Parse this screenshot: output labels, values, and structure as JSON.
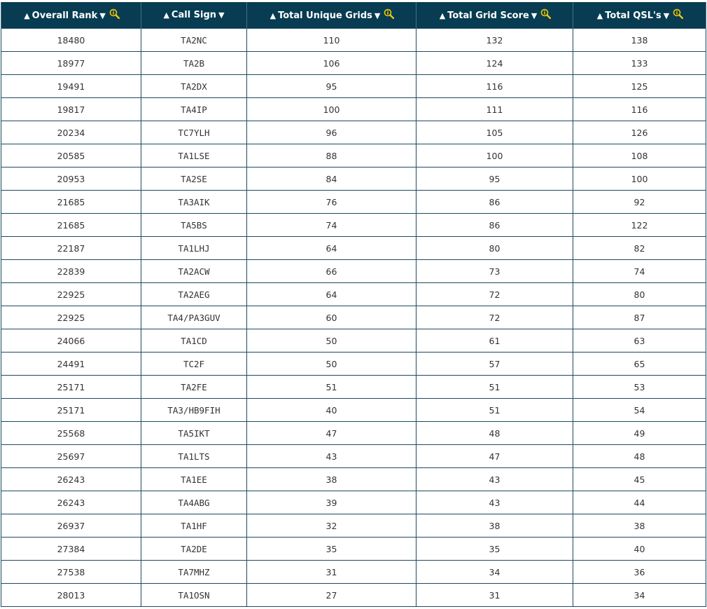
{
  "colors": {
    "header_bg": "#073c52",
    "header_text": "#ffffff",
    "icon": "#f2c800",
    "border": "#1e4a5e",
    "cell_text": "#333333"
  },
  "columns": [
    {
      "label": "Overall Rank",
      "sort_up": "▲",
      "sort_down": "▼",
      "has_search": true,
      "icon": "magnifier-info-icon"
    },
    {
      "label": "Call Sign",
      "sort_up": "▲",
      "sort_down": "▼",
      "has_search": false,
      "icon": ""
    },
    {
      "label": "Total Unique Grids",
      "sort_up": "▲",
      "sort_down": "▼",
      "has_search": true,
      "icon": "magnifier-info-icon"
    },
    {
      "label": "Total Grid Score",
      "sort_up": "▲",
      "sort_down": "▼",
      "has_search": true,
      "icon": "magnifier-info-icon"
    },
    {
      "label": "Total QSL's",
      "sort_up": "▲",
      "sort_down": "▼",
      "has_search": true,
      "icon": "magnifier-info-icon"
    }
  ],
  "rows": [
    [
      "18480",
      "TA2NC",
      "110",
      "132",
      "138"
    ],
    [
      "18977",
      "TA2B",
      "106",
      "124",
      "133"
    ],
    [
      "19491",
      "TA2DX",
      "95",
      "116",
      "125"
    ],
    [
      "19817",
      "TA4IP",
      "100",
      "111",
      "116"
    ],
    [
      "20234",
      "TC7YLH",
      "96",
      "105",
      "126"
    ],
    [
      "20585",
      "TA1LSE",
      "88",
      "100",
      "108"
    ],
    [
      "20953",
      "TA2SE",
      "84",
      "95",
      "100"
    ],
    [
      "21685",
      "TA3AIK",
      "76",
      "86",
      "92"
    ],
    [
      "21685",
      "TA5BS",
      "74",
      "86",
      "122"
    ],
    [
      "22187",
      "TA1LHJ",
      "64",
      "80",
      "82"
    ],
    [
      "22839",
      "TA2ACW",
      "66",
      "73",
      "74"
    ],
    [
      "22925",
      "TA2AEG",
      "64",
      "72",
      "80"
    ],
    [
      "22925",
      "TA4/PA3GUV",
      "60",
      "72",
      "87"
    ],
    [
      "24066",
      "TA1CD",
      "50",
      "61",
      "63"
    ],
    [
      "24491",
      "TC2F",
      "50",
      "57",
      "65"
    ],
    [
      "25171",
      "TA2FE",
      "51",
      "51",
      "53"
    ],
    [
      "25171",
      "TA3/HB9FIH",
      "40",
      "51",
      "54"
    ],
    [
      "25568",
      "TA5IKT",
      "47",
      "48",
      "49"
    ],
    [
      "25697",
      "TA1LTS",
      "43",
      "47",
      "48"
    ],
    [
      "26243",
      "TA1EE",
      "38",
      "43",
      "45"
    ],
    [
      "26243",
      "TA4ABG",
      "39",
      "43",
      "44"
    ],
    [
      "26937",
      "TA1HF",
      "32",
      "38",
      "38"
    ],
    [
      "27384",
      "TA2DE",
      "35",
      "35",
      "40"
    ],
    [
      "27538",
      "TA7MHZ",
      "31",
      "34",
      "36"
    ],
    [
      "28013",
      "TA1OSN",
      "27",
      "31",
      "34"
    ]
  ]
}
